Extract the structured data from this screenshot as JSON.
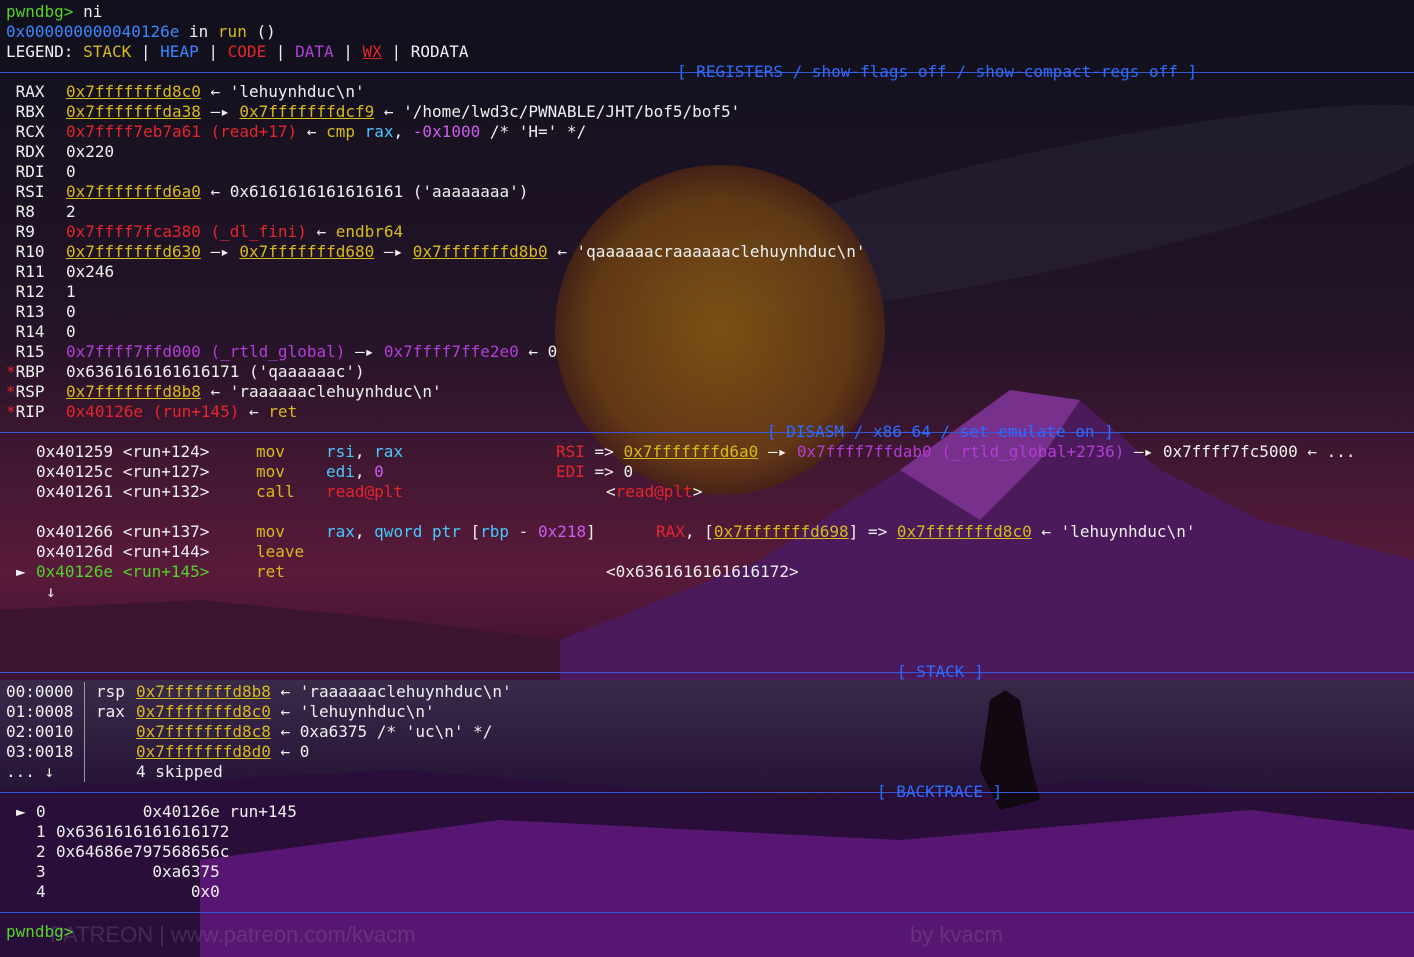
{
  "top": {
    "prompt": "pwndbg>",
    "command": " ni",
    "location_addr": "0x000000000040126e",
    "location_in": " in ",
    "location_func": "run",
    "location_args": " ()"
  },
  "legend": {
    "label": "LEGEND:",
    "stack": "STACK",
    "heap": "HEAP",
    "code": "CODE",
    "data": "DATA",
    "wx": "WX",
    "rodata": "RODATA",
    "sep": "|"
  },
  "headers": {
    "registers": "[ REGISTERS / show-flags off / show-compact-regs off ]",
    "disasm": "[ DISASM / x86-64 / set emulate on ]",
    "stack": "[ STACK ]",
    "backtrace": "[ BACKTRACE ]"
  },
  "registers": [
    {
      "name": "RAX",
      "parts": [
        [
          "0x7fffffffd8c0",
          "yel u"
        ],
        [
          " ← 'lehuynhduc\\n'",
          "wht"
        ]
      ]
    },
    {
      "name": "RBX",
      "parts": [
        [
          "0x7fffffffda38",
          "yel u"
        ],
        [
          " —▸ ",
          "wht"
        ],
        [
          "0x7fffffffdcf9",
          "yel u"
        ],
        [
          " ← '/home/lwd3c/PWNABLE/JHT/bof5/bof5'",
          "wht"
        ]
      ]
    },
    {
      "name": "RCX",
      "parts": [
        [
          "0x7ffff7eb7a61 (read+17)",
          "red"
        ],
        [
          " ← ",
          "wht"
        ],
        [
          "cmp ",
          "yel"
        ],
        [
          "rax",
          "cyn"
        ],
        [
          ", ",
          "wht"
        ],
        [
          "-0x1000",
          "num"
        ],
        [
          " /* 'H=' */",
          "wht"
        ]
      ]
    },
    {
      "name": "RDX",
      "parts": [
        [
          "0x220",
          "wht"
        ]
      ]
    },
    {
      "name": "RDI",
      "parts": [
        [
          "0",
          "wht"
        ]
      ]
    },
    {
      "name": "RSI",
      "parts": [
        [
          "0x7fffffffd6a0",
          "yel u"
        ],
        [
          " ← 0x6161616161616161 ('aaaaaaaa')",
          "wht"
        ]
      ]
    },
    {
      "name": "R8",
      "parts": [
        [
          "2",
          "wht"
        ]
      ]
    },
    {
      "name": "R9",
      "parts": [
        [
          "0x7ffff7fca380 (_dl_fini)",
          "red"
        ],
        [
          " ← ",
          "wht"
        ],
        [
          "endbr64",
          "yel"
        ]
      ]
    },
    {
      "name": "R10",
      "parts": [
        [
          "0x7fffffffd630",
          "yel u"
        ],
        [
          " —▸ ",
          "wht"
        ],
        [
          "0x7fffffffd680",
          "yel u"
        ],
        [
          " —▸ ",
          "wht"
        ],
        [
          "0x7fffffffd8b0",
          "yel u"
        ],
        [
          " ← 'qaaaaaacraaaaaaclehuynhduc\\n'",
          "wht"
        ]
      ]
    },
    {
      "name": "R11",
      "parts": [
        [
          "0x246",
          "wht"
        ]
      ]
    },
    {
      "name": "R12",
      "parts": [
        [
          "1",
          "wht"
        ]
      ]
    },
    {
      "name": "R13",
      "parts": [
        [
          "0",
          "wht"
        ]
      ]
    },
    {
      "name": "R14",
      "parts": [
        [
          "0",
          "wht"
        ]
      ]
    },
    {
      "name": "R15",
      "parts": [
        [
          "0x7ffff7ffd000 (_rtld_global)",
          "pur"
        ],
        [
          " —▸ ",
          "wht"
        ],
        [
          "0x7ffff7ffe2e0",
          "pur"
        ],
        [
          " ← 0",
          "wht"
        ]
      ]
    },
    {
      "name": "*RBP",
      "mark": true,
      "parts": [
        [
          "0x6361616161616171 ('qaaaaaac')",
          "wht"
        ]
      ]
    },
    {
      "name": "*RSP",
      "mark": true,
      "parts": [
        [
          "0x7fffffffd8b8",
          "yel u"
        ],
        [
          " ← 'raaaaaaclehuynhduc\\n'",
          "wht"
        ]
      ]
    },
    {
      "name": "*RIP",
      "mark": true,
      "parts": [
        [
          "0x40126e (run+145)",
          "red"
        ],
        [
          " ← ",
          "wht"
        ],
        [
          "ret",
          "yel"
        ]
      ]
    }
  ],
  "disasm": [
    {
      "arrow": "",
      "addr": "0x401259 <run+124>",
      "mnem": "mov",
      "ops": [
        [
          "rsi",
          "cyn"
        ],
        [
          ", ",
          "wht"
        ],
        [
          "rax",
          "cyn"
        ]
      ],
      "cmt": [
        [
          "RSI",
          "red"
        ],
        [
          " => ",
          "wht"
        ],
        [
          "0x7fffffffd6a0",
          "yel u"
        ],
        [
          " —▸ ",
          "wht"
        ],
        [
          "0x7ffff7ffdab0 (_rtld_global+2736)",
          "pur"
        ],
        [
          " —▸ 0x7ffff7fc5000 ← ...",
          "wht"
        ]
      ],
      "cmt_col": "556px"
    },
    {
      "arrow": "",
      "addr": "0x40125c <run+127>",
      "mnem": "mov",
      "ops": [
        [
          "edi",
          "cyn"
        ],
        [
          ", ",
          "wht"
        ],
        [
          "0",
          "num"
        ]
      ],
      "cmt": [
        [
          "EDI",
          "red"
        ],
        [
          " => 0",
          "wht"
        ]
      ],
      "cmt_col": "556px"
    },
    {
      "arrow": "",
      "addr": "0x401261 <run+132>",
      "mnem": "call",
      "ops": [
        [
          "read@plt",
          "red"
        ]
      ],
      "cmt": [
        [
          "<",
          "wht"
        ],
        [
          "read@plt",
          "red"
        ],
        [
          ">",
          "wht"
        ]
      ],
      "cmt_col": "606px"
    },
    {
      "blank": true
    },
    {
      "arrow": "",
      "addr": "0x401266 <run+137>",
      "mnem": "mov",
      "ops": [
        [
          "rax",
          "cyn"
        ],
        [
          ", ",
          "wht"
        ],
        [
          "qword ptr ",
          "cyn"
        ],
        [
          "[",
          "wht"
        ],
        [
          "rbp",
          "cyn"
        ],
        [
          " - ",
          "wht"
        ],
        [
          "0x218",
          "num"
        ],
        [
          "]",
          "wht"
        ]
      ],
      "cmt": [
        [
          "RAX",
          "red"
        ],
        [
          ", [",
          "wht"
        ],
        [
          "0x7fffffffd698",
          "yel u"
        ],
        [
          "] => ",
          "wht"
        ],
        [
          "0x7fffffffd8c0",
          "yel u"
        ],
        [
          " ← 'lehuynhduc\\n'",
          "wht"
        ]
      ],
      "cmt_col": "656px"
    },
    {
      "arrow": "",
      "addr": "0x40126d <run+144>",
      "mnem": "leave",
      "ops": [],
      "cmt": [],
      "cmt_col": "556px"
    },
    {
      "arrow": "►",
      "current": true,
      "addr": "0x40126e <run+145>",
      "mnem": "ret",
      "ops": [],
      "cmt": [
        [
          "<0x6361616161616172>",
          "wht"
        ]
      ],
      "cmt_col": "606px"
    }
  ],
  "disasm_more": "↓",
  "stack": [
    {
      "off": "00:0000",
      "reg": "rsp",
      "addr": "0x7fffffffd8b8",
      "rest": " ← 'raaaaaaclehuynhduc\\n'"
    },
    {
      "off": "01:0008",
      "reg": "rax",
      "addr": "0x7fffffffd8c0",
      "rest": " ← 'lehuynhduc\\n'"
    },
    {
      "off": "02:0010",
      "reg": "",
      "addr": "0x7fffffffd8c8",
      "rest": " ← 0xa6375 /* 'uc\\n' */"
    },
    {
      "off": "03:0018",
      "reg": "",
      "addr": "0x7fffffffd8d0",
      "rest": " ← 0"
    }
  ],
  "stack_skip": {
    "off": "... ↓",
    "text": "4 skipped"
  },
  "backtrace": [
    {
      "mark": "►",
      "idx": "0",
      "text": "         0x40126e run+145"
    },
    {
      "mark": "",
      "idx": "1",
      "text": "0x6361616161616172"
    },
    {
      "mark": "",
      "idx": "2",
      "text": "0x64686e797568656c"
    },
    {
      "mark": "",
      "idx": "3",
      "text": "          0xa6375"
    },
    {
      "mark": "",
      "idx": "4",
      "text": "              0x0"
    }
  ],
  "bottom_prompt": "pwndbg>",
  "watermark": {
    "left": "PATREON | www.patreon.com/kvacm",
    "right": "by kvacm"
  }
}
